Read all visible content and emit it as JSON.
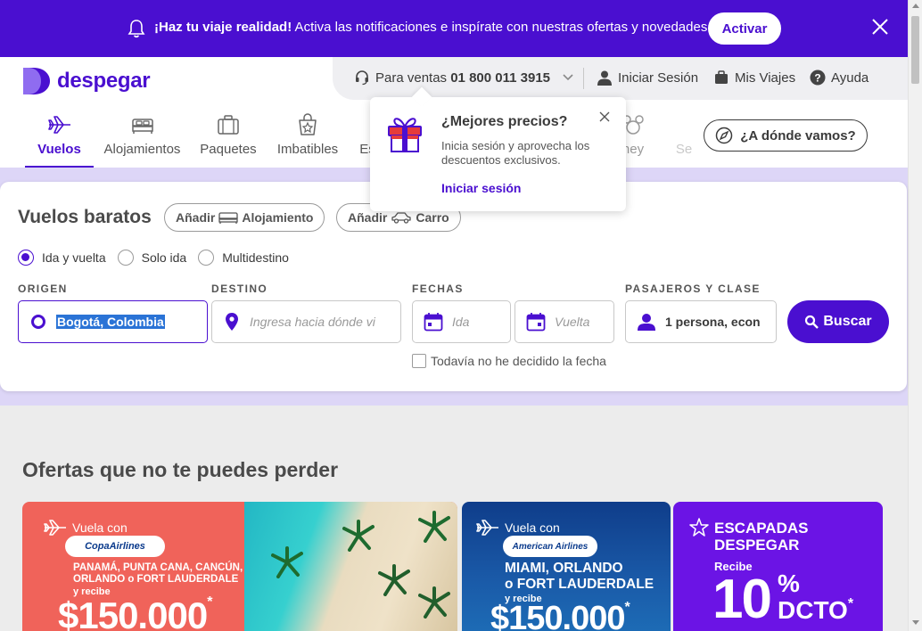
{
  "notification": {
    "strong": "¡Haz tu viaje realidad!",
    "text": " Activa las notificaciones e inspírate con nuestras ofertas y novedades.",
    "button": "Activar"
  },
  "brand": {
    "name": "despegar",
    "color": "#4a0fd0"
  },
  "topbar": {
    "sales_prefix": "Para ventas ",
    "sales_phone": "01 800 011 3915",
    "login": "Iniciar Sesión",
    "trips": "Mis Viajes",
    "help": "Ayuda"
  },
  "tabs": [
    {
      "label": "Vuelos",
      "icon": "airplane-icon"
    },
    {
      "label": "Alojamientos",
      "icon": "bed-icon"
    },
    {
      "label": "Paquetes",
      "icon": "suitcase-icon"
    },
    {
      "label": "Imbatibles",
      "icon": "discount-bag-icon"
    },
    {
      "label": "Es",
      "icon": ""
    },
    {
      "label": "ney",
      "icon": "mickey-icon"
    },
    {
      "label": "Se",
      "icon": ""
    }
  ],
  "donde_button": "¿A dónde vamos?",
  "popup": {
    "title": "¿Mejores precios?",
    "body": "Inicia sesión y aprovecha los descuentos exclusivos.",
    "link": "Iniciar sesión"
  },
  "search": {
    "title": "Vuelos baratos",
    "add_word": "Añadir",
    "add_hotel": "Alojamiento",
    "add_car": "Carro",
    "trip_types": [
      "Ida y vuelta",
      "Solo ida",
      "Multidestino"
    ],
    "selected_trip_type": "Ida y vuelta",
    "labels": {
      "origin": "ORIGEN",
      "destination": "DESTINO",
      "dates": "FECHAS",
      "passengers": "PASAJEROS Y CLASE"
    },
    "origin_value": "Bogotá, Colombia",
    "destination_placeholder": "Ingresa hacia dónde vi",
    "depart_placeholder": "Ida",
    "return_placeholder": "Vuelta",
    "passengers_value": "1 persona, econ",
    "search_button": "Buscar",
    "no_date": "Todavía no he decidido la fecha"
  },
  "offers": {
    "title": "Ofertas que no te puedes perder",
    "banners": [
      {
        "vuela": "Vuela con",
        "airline": "CopaAirlines",
        "destinations_1": "PANAMÁ, PUNTA CANA, CANCÚN,",
        "destinations_2": "ORLANDO o FORT LAUDERDALE",
        "recibe": "y recibe",
        "amount": "$150.000",
        "asterisk": "*"
      },
      {
        "vuela": "Vuela con",
        "airline": "American Airlines",
        "destinations_1": "MIAMI, ORLANDO",
        "destinations_2": "o FORT LAUDERDALE",
        "recibe": "y recibe",
        "amount": "$150.000",
        "asterisk": "*"
      },
      {
        "line1": "ESCAPADAS",
        "line2": "DESPEGAR",
        "recibe": "Recibe",
        "amount": "10",
        "percent": "%",
        "dcto": "DCTO",
        "asterisk": "*"
      }
    ]
  }
}
